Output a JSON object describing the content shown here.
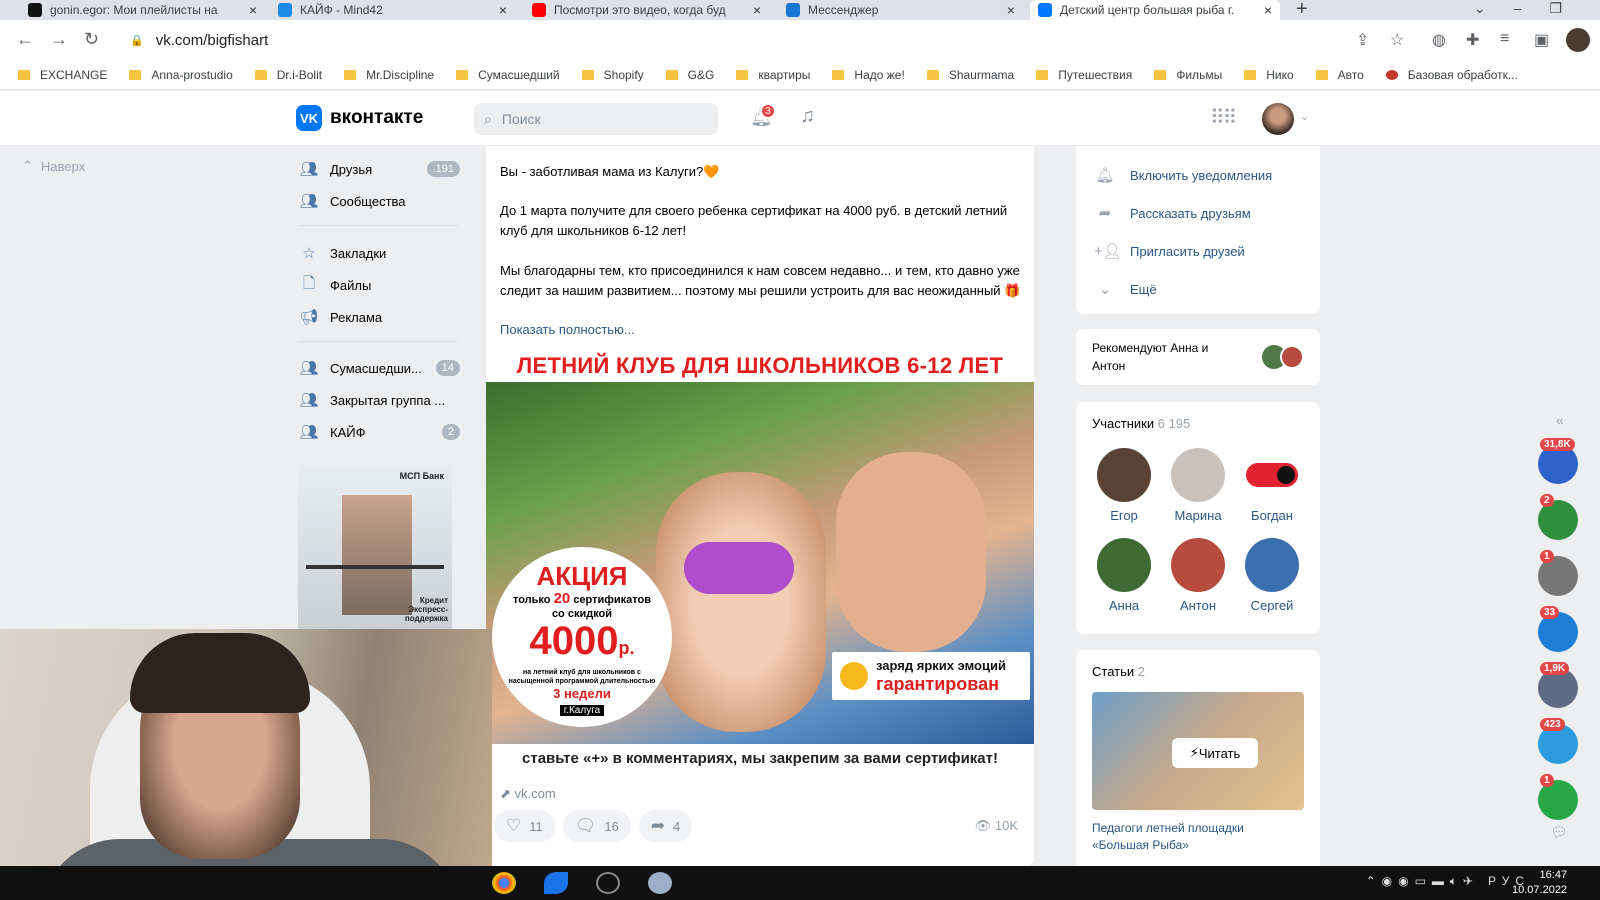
{
  "browser": {
    "tabs": [
      {
        "title": "gonin.egor: Мои плейлисты на ",
        "fav": "#111111"
      },
      {
        "title": "КАЙФ - Mind42",
        "fav": "#1e88e5"
      },
      {
        "title": "Посмотри это видео, когда буд",
        "fav": "#ff0000"
      },
      {
        "title": "Мессенджер",
        "fav": "#1976d2"
      },
      {
        "title": "Детский центр большая рыба г.",
        "fav": "#0077ff"
      }
    ],
    "url": "vk.com/bigfishart",
    "bookmarks": [
      "EXCHANGE",
      "Anna-prostudio",
      "Dr.i-Bolit",
      "Mr.Discipline",
      "Сумасшедший",
      "Shopify",
      "G&G",
      "квартиры",
      "Надо же!",
      "Shaurmama",
      "Путешествия",
      "Фильмы",
      "Нико",
      "Авто",
      "Базовая обработк..."
    ]
  },
  "vk": {
    "logo_text": "вконтакте",
    "logo_mark": "VK",
    "search_placeholder": "Поиск",
    "notifications_count": "3",
    "up_label": "Наверх"
  },
  "leftnav": {
    "friends": {
      "label": "Друзья",
      "count": ".191"
    },
    "communities": {
      "label": "Сообщества"
    },
    "bookmarks": {
      "label": "Закладки"
    },
    "files": {
      "label": "Файлы"
    },
    "ads": {
      "label": "Реклама"
    },
    "group1": {
      "label": "Сумасшедши...",
      "count": "14"
    },
    "group2": {
      "label": "Закрытая группа ..."
    },
    "group3": {
      "label": "КАЙФ",
      "count": "2"
    }
  },
  "ad": {
    "bank": "МСП Банк",
    "caption": "Кредит Экспресс-поддержка"
  },
  "post": {
    "p1": "Вы - заботливая мама из Калуги?🧡",
    "p2": "До 1 марта получите для своего ребенка сертификат на 4000 руб. в детский летний клуб для школьников 6-12 лет!",
    "p3": "Мы благодарны тем, кто присоединился к нам совсем недавно... и тем, кто давно уже следит за нашим развитием... поэтому мы решили устроить для вас неожиданный 🎁",
    "show_more": "Показать полностью...",
    "banner": "ЛЕТНИЙ КЛУБ ДЛЯ ШКОЛЬНИКОВ 6-12 ЛЕТ",
    "promo_title": "АКЦИЯ",
    "promo_line1a": "только",
    "promo_line1b": "20",
    "promo_line1c": "сертификатов",
    "promo_line2": "со скидкой",
    "promo_price": "4000",
    "promo_currency": "р.",
    "promo_small": "на летний клуб для школьников с насыщенной программой длительностью",
    "promo_weeks": "3 недели",
    "promo_city": "г.Калуга",
    "emotion_line1": "заряд ярких эмоций",
    "emotion_line2": "гарантирован",
    "caption": "ставьте «+» в комментариях, мы закрепим за вами сертификат!",
    "link": "vk.com",
    "likes": "11",
    "comments": "16",
    "shares": "4",
    "views": "10K"
  },
  "right": {
    "actions": [
      {
        "label": "Включить уведомления",
        "icon": "bell-icon"
      },
      {
        "label": "Рассказать друзьям",
        "icon": "share-icon"
      },
      {
        "label": "Пригласить друзей",
        "icon": "add-friend-icon"
      },
      {
        "label": "Ещё",
        "icon": "chevron-down-icon"
      }
    ],
    "recommend": "Рекомендуют Анна и Антон",
    "members_title": "Участники",
    "members_count": "6 195",
    "members": [
      {
        "name": "Егор",
        "color": "#5a4336"
      },
      {
        "name": "Марина",
        "color": "#c7c2bd"
      },
      {
        "name": "Богдан",
        "color": "#e0232e"
      },
      {
        "name": "Анна",
        "color": "#3f6a34"
      },
      {
        "name": "Антон",
        "color": "#b84b3f"
      },
      {
        "name": "Сергей",
        "color": "#3a6fb0"
      }
    ],
    "articles_title": "Статьи",
    "articles_count": "2",
    "read_label": "Читать",
    "article_title": "Педагоги летней площадки «Большая Рыба»"
  },
  "rail": [
    {
      "count": "31,8K",
      "color": "#2f63c9"
    },
    {
      "count": "2",
      "color": "#2f8f3d"
    },
    {
      "count": "1",
      "color": "#777777"
    },
    {
      "count": "33",
      "color": "#1e7ed6"
    },
    {
      "count": "1,9K",
      "color": "#5f6b85"
    },
    {
      "count": "423",
      "color": "#2d9ae0"
    },
    {
      "count": "1",
      "color": "#27a745"
    }
  ],
  "taskbar": {
    "lang": "РУС",
    "time": "16:47",
    "date": "10.07.2022"
  }
}
